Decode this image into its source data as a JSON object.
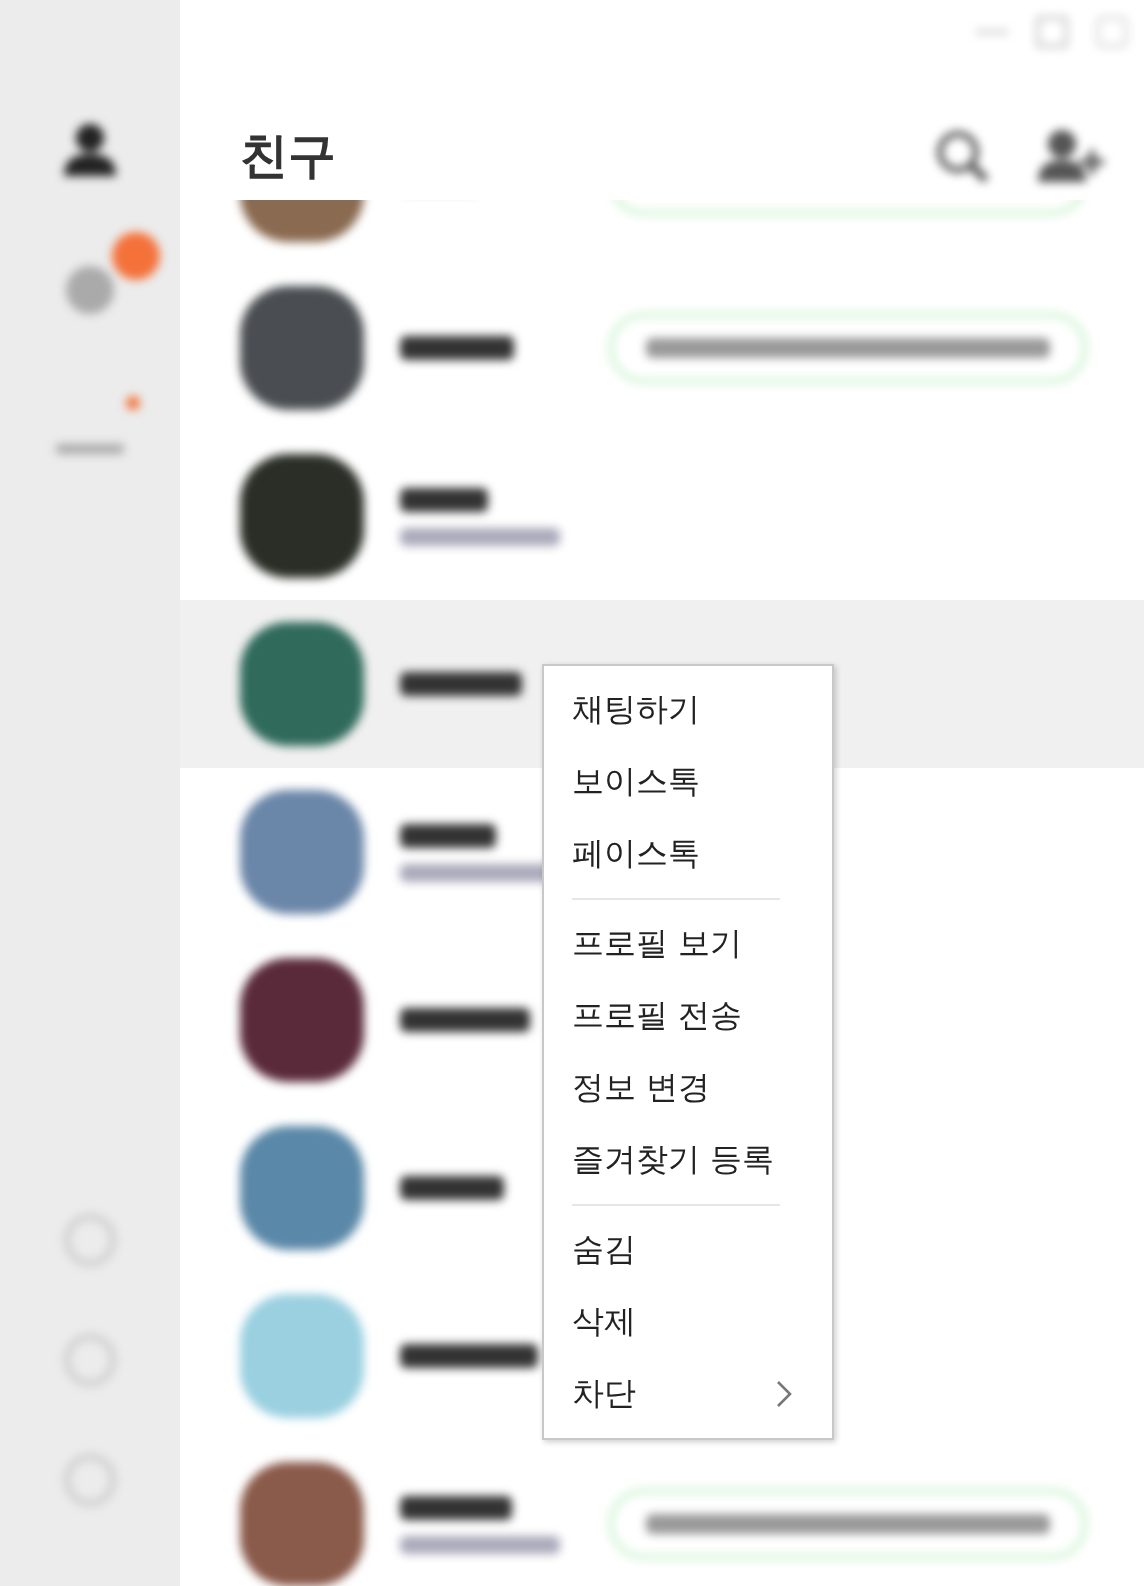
{
  "title": "친구",
  "sidebar": {
    "items": [
      {
        "kind": "friends",
        "selected": true,
        "badge": false
      },
      {
        "kind": "chats",
        "selected": false,
        "badge": true
      },
      {
        "kind": "more",
        "selected": false,
        "badge": true
      }
    ]
  },
  "friends": [
    {
      "color": "#8a6a50",
      "selected": false,
      "status_message": true,
      "second_line": false
    },
    {
      "color": "#4a4e52",
      "selected": false,
      "status_message": true,
      "second_line": false
    },
    {
      "color": "#2a2e26",
      "selected": false,
      "status_message": false,
      "second_line": true
    },
    {
      "color": "#2f6a5a",
      "selected": true,
      "status_message": false,
      "second_line": false
    },
    {
      "color": "#6a86a8",
      "selected": false,
      "status_message": false,
      "second_line": true
    },
    {
      "color": "#5a2a3a",
      "selected": false,
      "status_message": false,
      "second_line": false
    },
    {
      "color": "#5a88a8",
      "selected": false,
      "status_message": false,
      "second_line": false
    },
    {
      "color": "#9ad0e0",
      "selected": false,
      "status_message": false,
      "second_line": false
    },
    {
      "color": "#8a5a4a",
      "selected": false,
      "status_message": true,
      "second_line": true
    }
  ],
  "context_menu": [
    {
      "kind": "item",
      "label": "채팅하기",
      "submenu": false
    },
    {
      "kind": "item",
      "label": "보이스톡",
      "submenu": false
    },
    {
      "kind": "item",
      "label": "페이스톡",
      "submenu": false
    },
    {
      "kind": "separator"
    },
    {
      "kind": "item",
      "label": "프로필 보기",
      "submenu": false
    },
    {
      "kind": "item",
      "label": "프로필 전송",
      "submenu": false
    },
    {
      "kind": "item",
      "label": "정보 변경",
      "submenu": false
    },
    {
      "kind": "item",
      "label": "즐겨찾기 등록",
      "submenu": false
    },
    {
      "kind": "separator"
    },
    {
      "kind": "item",
      "label": "숨김",
      "submenu": false
    },
    {
      "kind": "item",
      "label": "삭제",
      "submenu": false
    },
    {
      "kind": "item",
      "label": "차단",
      "submenu": true
    }
  ]
}
